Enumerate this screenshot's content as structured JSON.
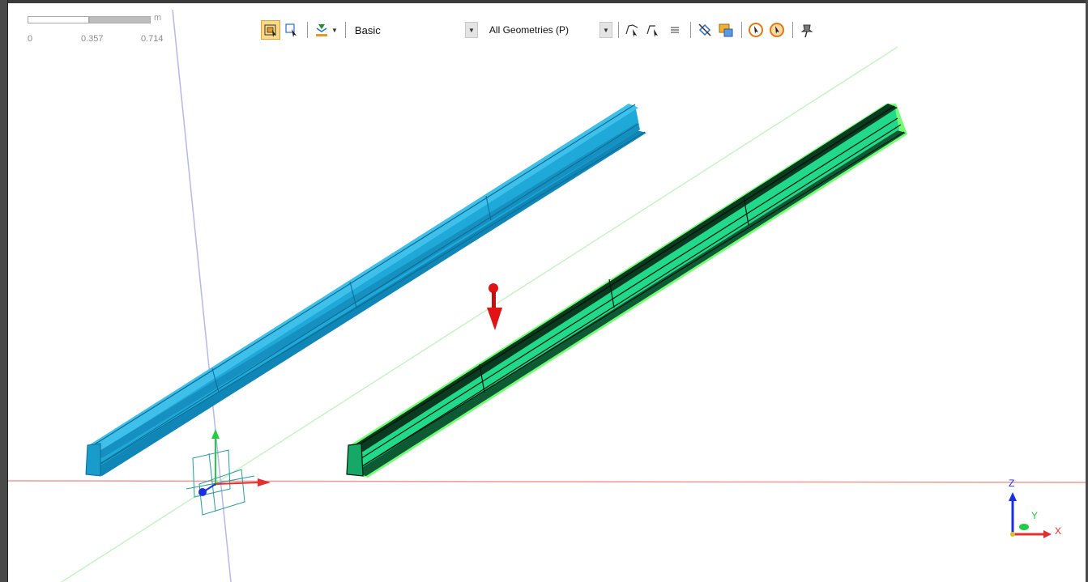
{
  "scale_bar": {
    "unit": "m",
    "ticks": [
      "0",
      "0.357",
      "0.714"
    ]
  },
  "toolbar": {
    "buttons": [
      {
        "name": "select-mode-icon",
        "active": true
      },
      {
        "name": "select-type-icon",
        "active": false
      },
      {
        "name": "explode-icon",
        "active": false
      }
    ],
    "view_mode_value": "Basic",
    "geometry_filter_value": "All Geometries (P)",
    "right_buttons": [
      "select-by-path-icon",
      "select-by-chain-icon",
      "align-icon",
      "hide-icon",
      "show-body-icon",
      "cursor-orange-icon",
      "cursor-target-icon",
      "pushpin-icon"
    ]
  },
  "triad": {
    "z_label": "Z",
    "y_label": "Y",
    "x_label": "X"
  },
  "colors": {
    "rail_blue": "#1fa9d8",
    "rail_green": "#22e88a",
    "selection_outline": "#00ff00",
    "x_axis": "#e03030",
    "y_axis": "#22cc44",
    "z_axis": "#1a30e0",
    "grid_line_green": "#c7f2c7",
    "grid_line_blue": "#b8b8e8",
    "load_arrow": "#e01414"
  }
}
